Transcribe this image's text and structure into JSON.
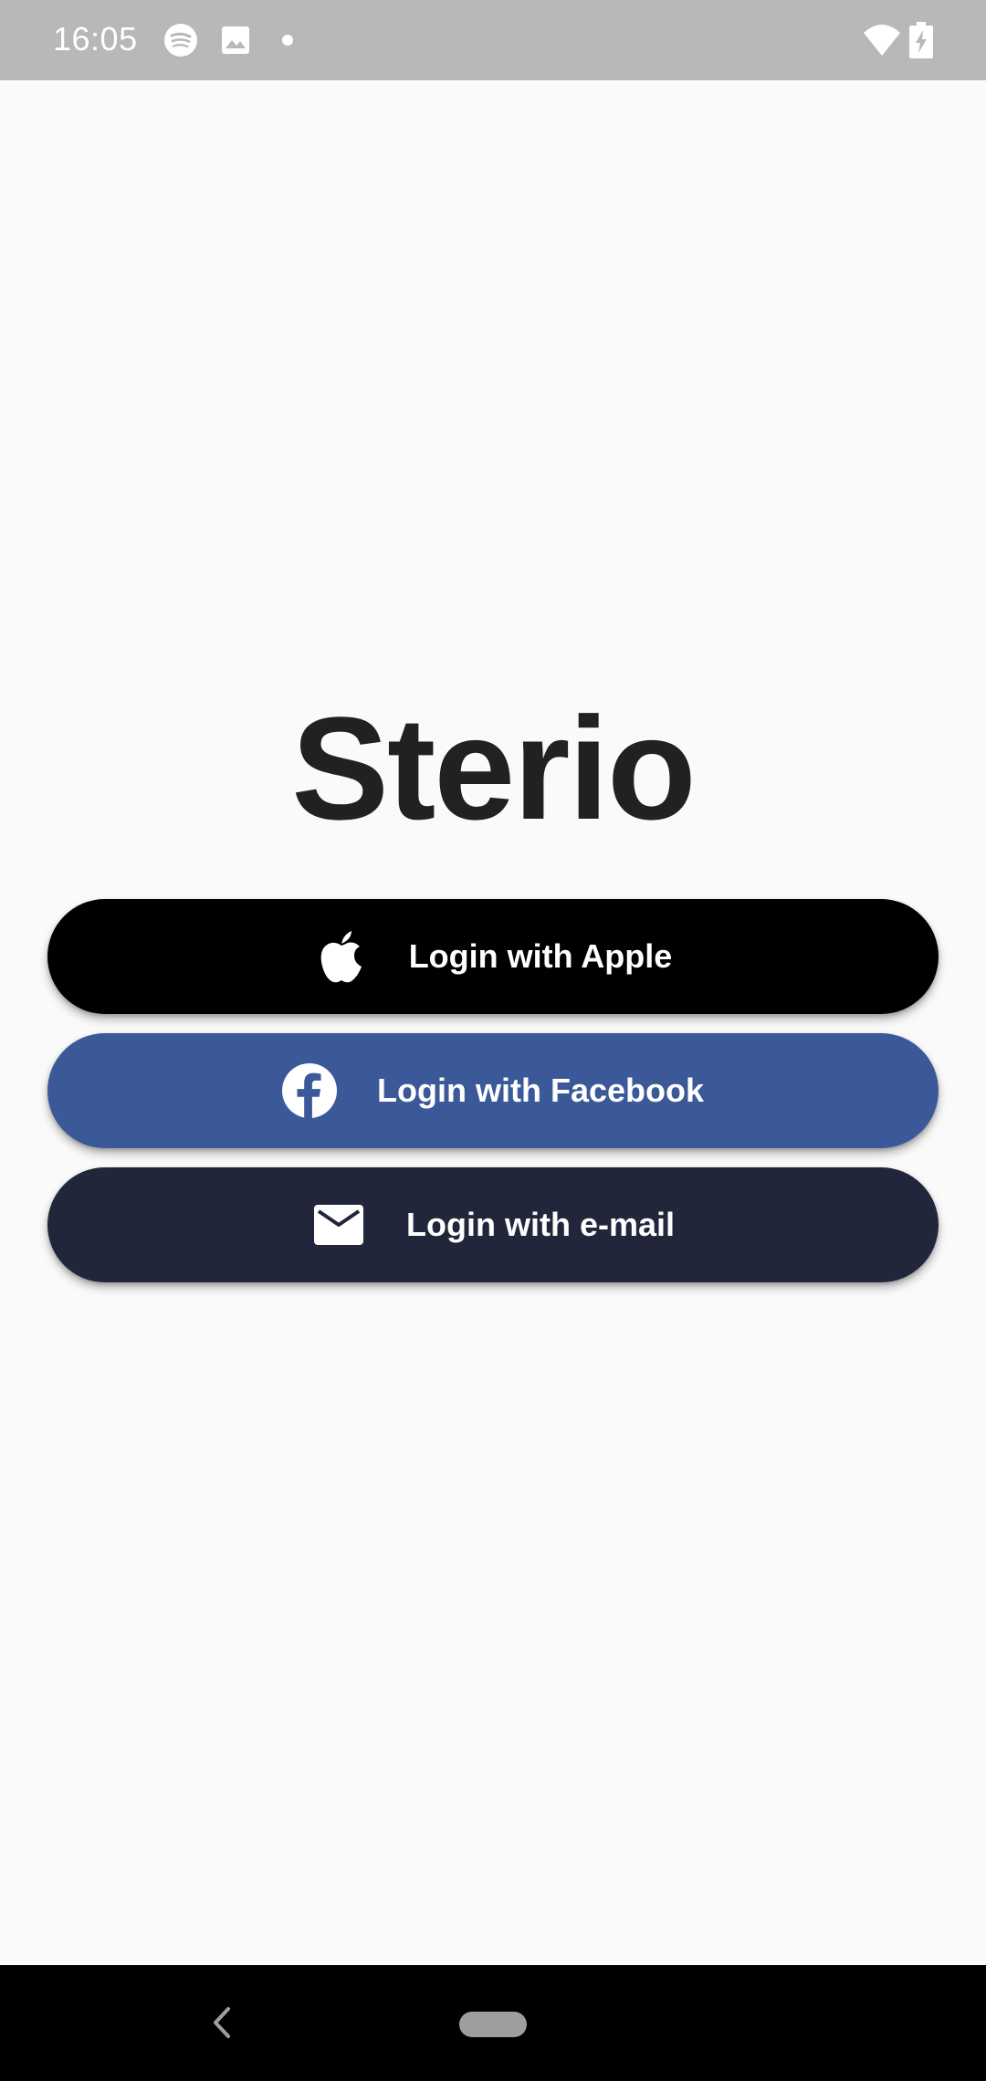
{
  "status_bar": {
    "time": "16:05",
    "left_icons": [
      "spotify-icon",
      "image-icon",
      "notification-dot"
    ],
    "right_icons": [
      "wifi-icon",
      "battery-charging-icon"
    ],
    "background": "#b8b8b8"
  },
  "app": {
    "title": "Sterio"
  },
  "buttons": {
    "apple": {
      "label": "Login with Apple",
      "icon": "apple-icon",
      "color": "#000000"
    },
    "facebook": {
      "label": "Login with Facebook",
      "icon": "facebook-icon",
      "color": "#3b5998"
    },
    "email": {
      "label": "Login with e-mail",
      "icon": "mail-icon",
      "color": "#22263a"
    }
  },
  "nav_bar": {
    "items": [
      "back-icon",
      "home-pill"
    ]
  }
}
